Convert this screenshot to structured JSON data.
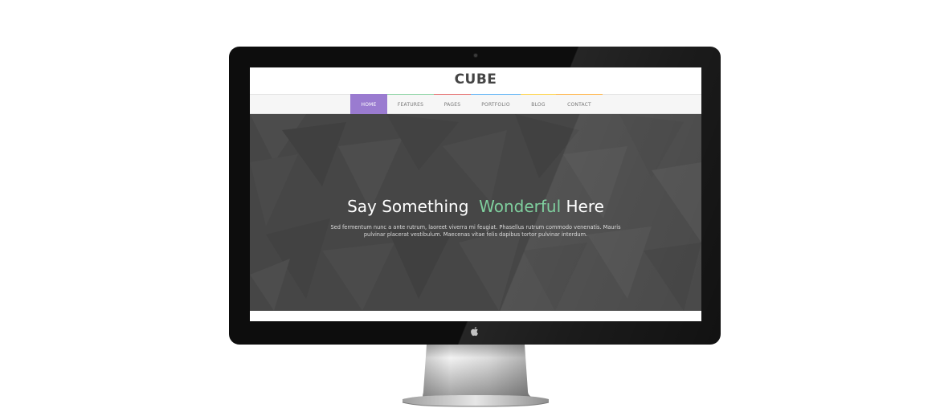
{
  "site": {
    "logo": "CUBE",
    "nav": [
      {
        "label": "HOME",
        "active": true,
        "accent": "#9a7bd0"
      },
      {
        "label": "FEATURES",
        "active": false,
        "accent": "#8fd5a6"
      },
      {
        "label": "PAGES",
        "active": false,
        "accent": "#e57373"
      },
      {
        "label": "PORTFOLIO",
        "active": false,
        "accent": "#64b5f6"
      },
      {
        "label": "BLOG",
        "active": false,
        "accent": "#ffd54f"
      },
      {
        "label": "CONTACT",
        "active": false,
        "accent": "#ffb74d"
      }
    ]
  },
  "hero": {
    "title_start": "Say Something",
    "title_accent": "Wonderful",
    "title_end": "Here",
    "text": "Sed fermentum nunc a ante rutrum, laoreet viverra mi feugiat. Phasellus rutrum commodo venenatis. Mauris pulvinar placerat vestibulum. Maecenas vitae felis dapibus tortor pulvinar interdum.",
    "accent_color": "#7fcf9e",
    "background_color": "#464646"
  },
  "device": {
    "icons": [
      "camera-dot",
      "apple-logo"
    ]
  }
}
